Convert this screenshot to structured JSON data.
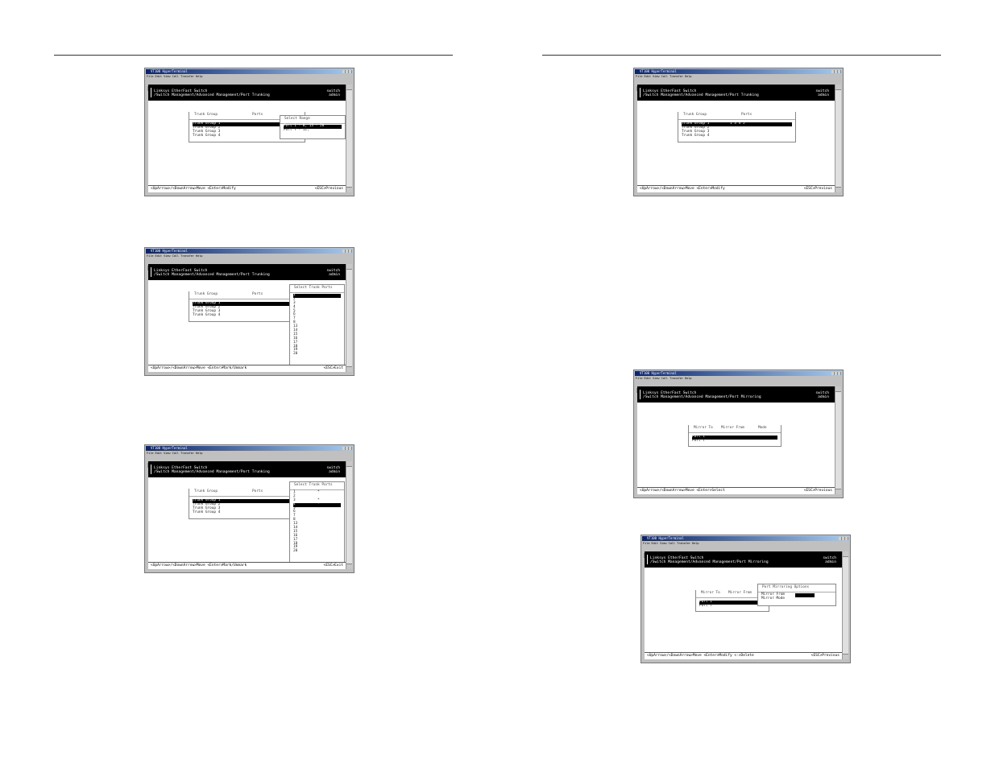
{
  "page": {},
  "window": {
    "title": "VT100 HyperTerminal",
    "menu": "File  Edit  View  Call  Transfer  Help",
    "header_line1": "Linksys EtherFast Switch",
    "header_right1": "switch",
    "header_right2": "admin"
  },
  "shots": {
    "s1": {
      "path": "/Switch Management/Advanced Management/Port Trunking",
      "status_left": "<UpArrow>/<DownArrow>Move  <Enter>Modify",
      "status_right": "<ESC>Previous",
      "table_head": [
        "Trunk Group",
        "Ports"
      ],
      "groups": [
        "Trunk Group 1",
        "Trunk Group 2",
        "Trunk Group 3",
        "Trunk Group 4"
      ],
      "popup_title": "Select Range",
      "popup_rows": [
        "Port  1 - 8, 13 - 20",
        "Port  7 - 12,"
      ]
    },
    "s2": {
      "path": "/Switch Management/Advanced Management/Port Trunking",
      "status_left": "<UpArrow>/<DownArrow>Move  <Enter>Mark/Unmark",
      "status_right": "<ESC>Exit",
      "table_head": [
        "Trunk Group",
        "Ports"
      ],
      "groups": [
        "Trunk Group 1",
        "Trunk Group 2",
        "Trunk Group 3",
        "Trunk Group 4"
      ],
      "popup_title": "Select Trunk Ports",
      "ports": [
        "1",
        "2",
        "3",
        "4",
        "5",
        "6",
        "7",
        "8",
        "13",
        "14",
        "15",
        "16",
        "17",
        "18",
        "19",
        "20"
      ]
    },
    "s3": {
      "path": "/Switch Management/Advanced Management/Port Trunking",
      "status_left": "<UpArrow>/<DownArrow>Move  <Enter>Mark/Unmark",
      "status_right": "<ESC>Exit",
      "table_head": [
        "Trunk Group",
        "Ports"
      ],
      "groups": [
        "Trunk Group 1",
        "Trunk Group 2",
        "Trunk Group 3",
        "Trunk Group 4"
      ],
      "popup_title": "Select Trunk Ports",
      "ports": [
        "1",
        "2",
        "3",
        "4",
        "5",
        "6",
        "7",
        "8",
        "13",
        "14",
        "15",
        "16",
        "17",
        "18",
        "19",
        "20"
      ],
      "marks": [
        "*",
        "",
        "*",
        "*",
        "*",
        "",
        "",
        "",
        "",
        "",
        "",
        "",
        "",
        "",
        "",
        ""
      ]
    },
    "s4": {
      "path": "/Switch Management/Advanced Management/Port Trunking",
      "status_left": "<UpArrow>/<DownArrow>Move  <Enter>Modify",
      "status_right": "<ESC>Previous",
      "table_head": [
        "Trunk Group",
        "Ports"
      ],
      "groups": [
        "Trunk Group 1",
        "Trunk Group 2",
        "Trunk Group 3",
        "Trunk Group 4"
      ],
      "group1_ports": "1  3  4  5"
    },
    "s5": {
      "path": "/Switch Management/Advanced Management/Port Mirroring",
      "status_left": "<UpArrow>/<DownArrow>Move  <Enter>Select",
      "status_right": "<ESC>Previous",
      "table_head": [
        "Mirror To",
        "Mirror From",
        "Mode"
      ],
      "rows": [
        "Port 1",
        "Port 7"
      ]
    },
    "s6": {
      "path": "/Switch Management/Advanced Management/Port Mirroring",
      "status_left": "<UpArrow>/<DownArrow>Move  <Enter>Modify  <->Delete",
      "status_right": "<ESC>Previous",
      "table_head": [
        "Mirror To",
        "Mirror From"
      ],
      "rows": [
        "Port 1",
        "Port 7"
      ],
      "popup_title": "Port Mirroring Options",
      "options": [
        "Mirror From",
        "Mirror Mode"
      ]
    }
  }
}
